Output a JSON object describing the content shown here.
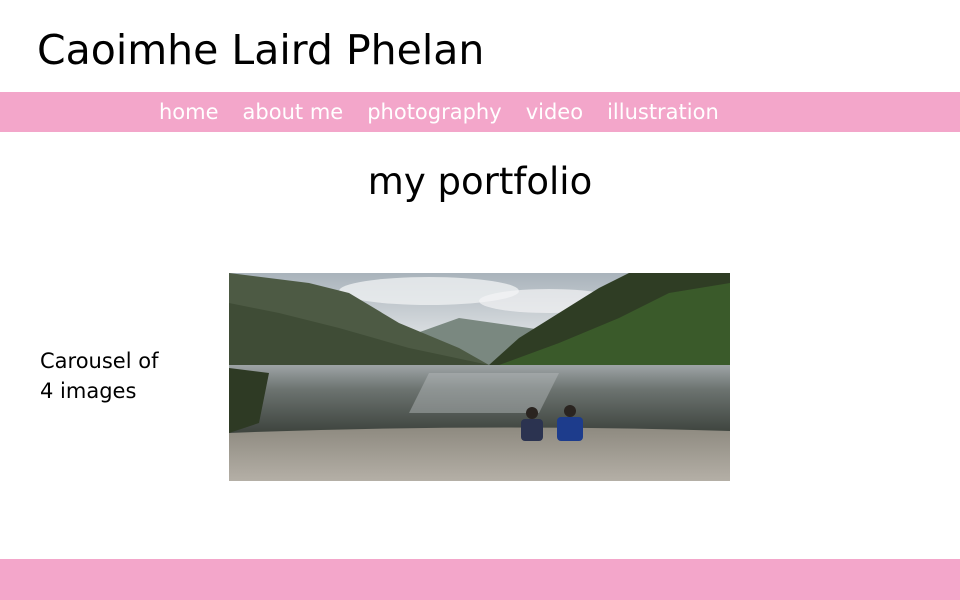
{
  "header": {
    "site_title": "Caoimhe Laird Phelan"
  },
  "nav": {
    "items": [
      {
        "label": "home"
      },
      {
        "label": "about me"
      },
      {
        "label": "photography"
      },
      {
        "label": "video"
      },
      {
        "label": "illustration"
      }
    ]
  },
  "main": {
    "heading": "my portfolio",
    "carousel_note_line1": "Carousel of",
    "carousel_note_line2": "4 images"
  },
  "colors": {
    "accent_pink": "#f3a6ca",
    "nav_text": "#ffffff",
    "text": "#000000"
  }
}
